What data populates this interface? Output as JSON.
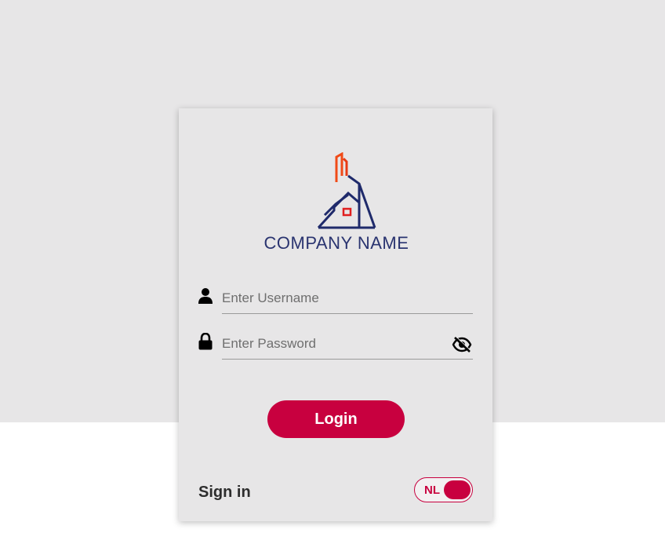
{
  "brand": {
    "company_name": "COMPANY NAME",
    "primary_color": "#c8003f",
    "logo_navy": "#1f2a6b",
    "logo_orange": "#f04a17"
  },
  "form": {
    "username_placeholder": "Enter Username",
    "username_value": "",
    "password_placeholder": "Enter Password",
    "password_value": "",
    "username_icon": "user-icon",
    "password_icon": "lock-icon",
    "visibility_icon": "eye-off-icon",
    "login_label": "Login"
  },
  "footer": {
    "sign_in_label": "Sign in",
    "language": "NL",
    "language_toggle_on": true
  }
}
